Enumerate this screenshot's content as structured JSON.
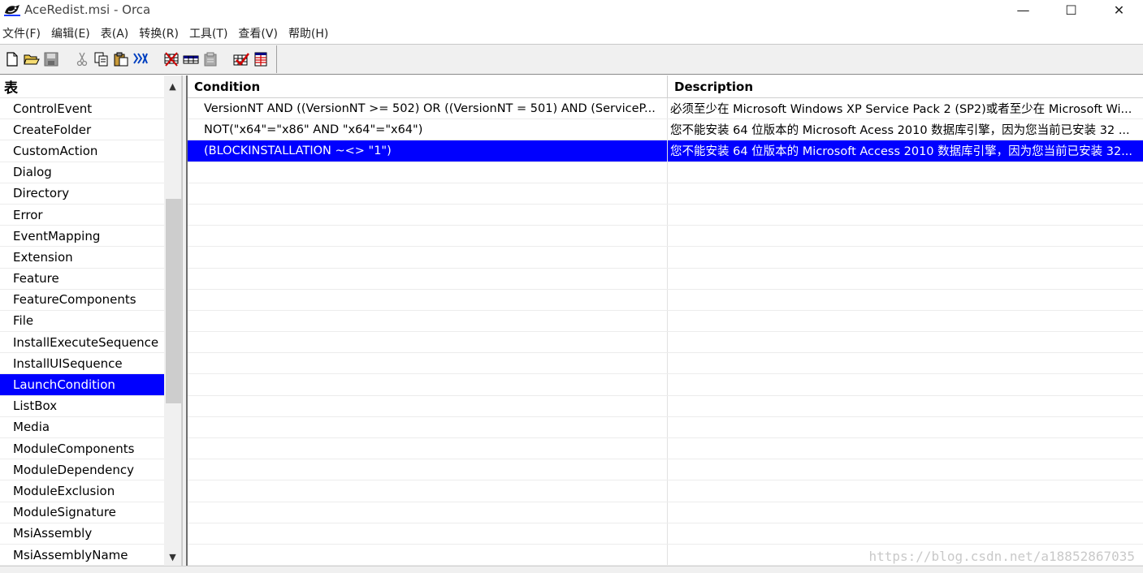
{
  "window": {
    "title": "AceRedist.msi - Orca",
    "minimize": "—",
    "maximize": "☐",
    "close": "✕"
  },
  "menu": [
    {
      "label": "文件(F)"
    },
    {
      "label": "编辑(E)"
    },
    {
      "label": "表(A)"
    },
    {
      "label": "转换(R)"
    },
    {
      "label": "工具(T)"
    },
    {
      "label": "查看(V)"
    },
    {
      "label": "帮助(H)"
    }
  ],
  "toolbar": {
    "icons": [
      "new-file-icon",
      "open-folder-icon",
      "save-icon",
      "cut-icon",
      "copy-icon",
      "paste-icon",
      "find-icon",
      "merge-module-icon",
      "table-icon",
      "clipboard-icon",
      "validate-icon",
      "summary-icon"
    ]
  },
  "left_pane": {
    "header": "表",
    "scroll_up": "▲",
    "scroll_down": "▼",
    "tables": [
      {
        "name": "ControlEvent"
      },
      {
        "name": "CreateFolder"
      },
      {
        "name": "CustomAction"
      },
      {
        "name": "Dialog"
      },
      {
        "name": "Directory"
      },
      {
        "name": "Error"
      },
      {
        "name": "EventMapping"
      },
      {
        "name": "Extension"
      },
      {
        "name": "Feature"
      },
      {
        "name": "FeatureComponents"
      },
      {
        "name": "File"
      },
      {
        "name": "InstallExecuteSequence"
      },
      {
        "name": "InstallUISequence"
      },
      {
        "name": "LaunchCondition"
      },
      {
        "name": "ListBox"
      },
      {
        "name": "Media"
      },
      {
        "name": "ModuleComponents"
      },
      {
        "name": "ModuleDependency"
      },
      {
        "name": "ModuleExclusion"
      },
      {
        "name": "ModuleSignature"
      },
      {
        "name": "MsiAssembly"
      },
      {
        "name": "MsiAssemblyName"
      }
    ],
    "selected_index": 13
  },
  "grid": {
    "columns": {
      "condition": "Condition",
      "description": "Description"
    },
    "rows": [
      {
        "condition": "VersionNT AND ((VersionNT >= 502) OR ((VersionNT = 501) AND (ServiceP...",
        "description": "必须至少在 Microsoft Windows XP Service Pack 2 (SP2)或者至少在 Microsoft Wi..."
      },
      {
        "condition": "NOT(\"x64\"=\"x86\" AND \"x64\"=\"x64\")",
        "description": "您不能安装 64 位版本的 Microsoft Acess 2010 数据库引擎，因为您当前已安装 32 ..."
      },
      {
        "condition": "(BLOCKINSTALLATION ~<> \"1\")",
        "description": "您不能安装 64 位版本的 Microsoft Access 2010 数据库引擎，因为您当前已安装 32..."
      }
    ],
    "selected_index": 2,
    "empty_rows": 19
  },
  "watermark": "https://blog.csdn.net/a18852867035",
  "colors": {
    "selection": "#0000ff",
    "toolbar_bg": "#f0f0f0"
  }
}
